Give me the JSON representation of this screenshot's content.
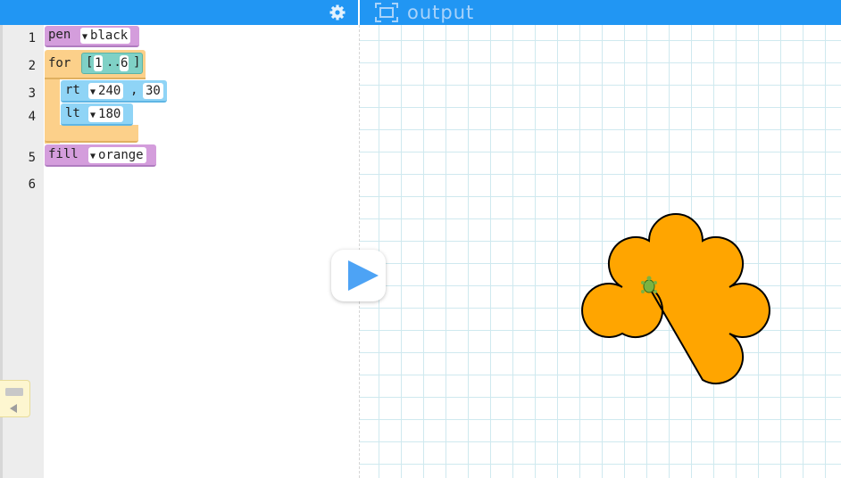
{
  "header": {
    "output_label": "output",
    "accent_color": "#2196f3",
    "icons": [
      "gear-icon",
      "output-panel-icon"
    ]
  },
  "editor": {
    "line_numbers": [
      "1",
      "2",
      "3",
      "4",
      "5",
      "6"
    ],
    "blocks": {
      "pen_keyword": "pen",
      "pen_color": "black",
      "for_keyword": "for",
      "range_open": "[",
      "range_start": "1",
      "range_dots": "..",
      "range_end": "6",
      "range_close": "]",
      "rt_keyword": "rt",
      "rt_angle": "240",
      "rt_comma": ",",
      "rt_radius": "30",
      "lt_keyword": "lt",
      "lt_angle": "180",
      "fill_keyword": "fill",
      "fill_color": "orange"
    }
  },
  "output": {
    "shape_fill": "#ffa500",
    "shape_stroke": "#000000",
    "petal_count": 6
  }
}
